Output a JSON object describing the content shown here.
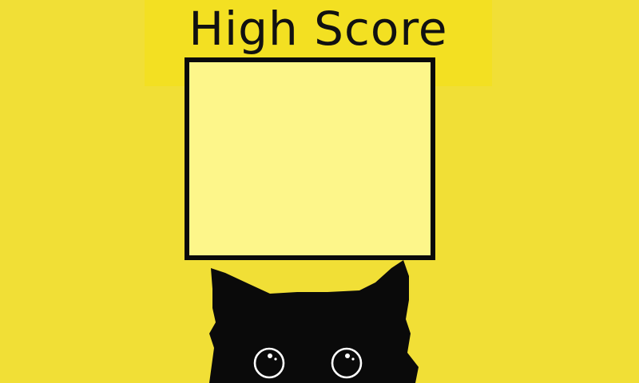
{
  "screen": {
    "title": "High Score",
    "colors": {
      "background": "#f1df36",
      "title_band": "#f3e022",
      "panel_fill": "#fdf68a",
      "panel_border": "#0a0a0a",
      "text": "#111111",
      "cat": "#0a0a0a",
      "eye": "#ffffff"
    }
  }
}
